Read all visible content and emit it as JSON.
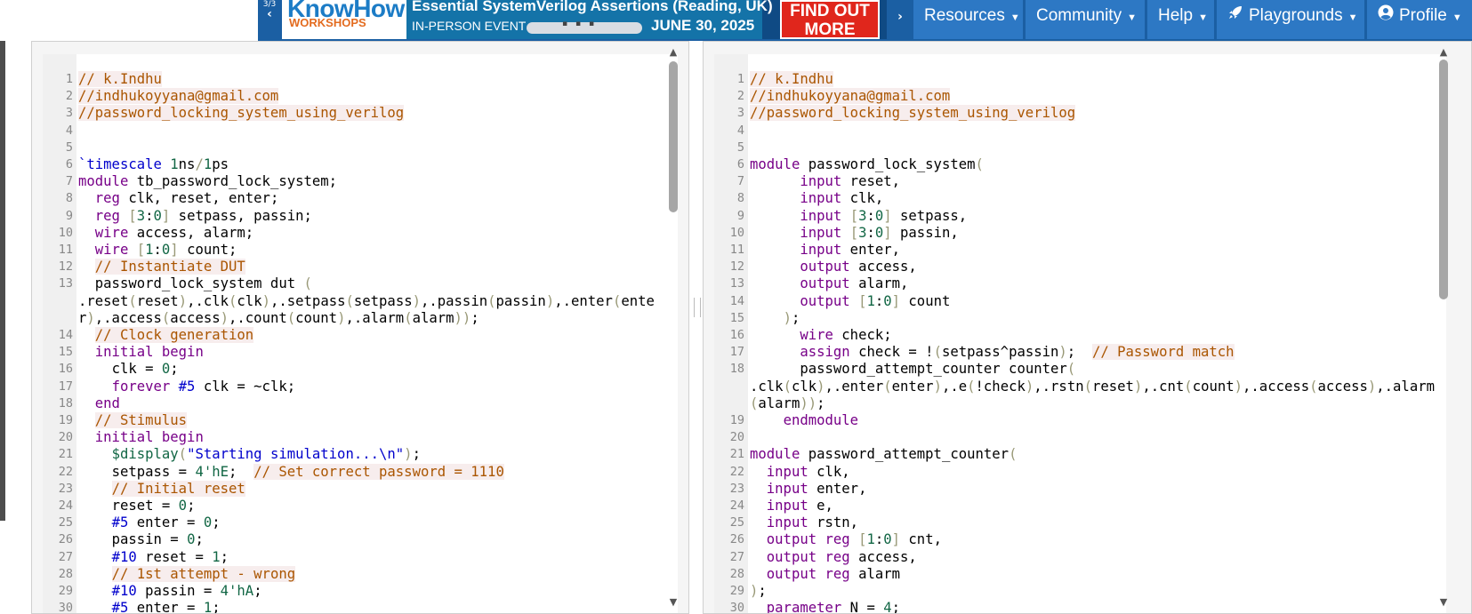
{
  "banner": {
    "counter": "3/3",
    "prev_arrow": "‹",
    "logo_title": "KnowHow",
    "logo_sub": "WORKSHOPS",
    "title": "Essential SystemVerilog Assertions (Reading, UK)",
    "event": "IN-PERSON EVENT",
    "date": "JUNE 30, 2025",
    "cta": "FIND OUT MORE"
  },
  "nav": {
    "next_arrow": "›",
    "resources": "Resources",
    "community": "Community",
    "help": "Help",
    "playgrounds": "Playgrounds",
    "profile": "Profile"
  },
  "left_editor": {
    "lines": [
      {
        "n": "1",
        "h": "<span class='c'>// k.Indhu</span>"
      },
      {
        "n": "2",
        "h": "<span class='c'>//indhukoyyana@gmail.com</span>"
      },
      {
        "n": "3",
        "h": "<span class='c'>//password_locking_system_using_verilog</span>"
      },
      {
        "n": "4",
        "h": ""
      },
      {
        "n": "5",
        "h": ""
      },
      {
        "n": "6",
        "h": "<span class='t'>`timescale</span> <span class='n'>1</span>ns<span class='b'>/</span><span class='n'>1</span>ps"
      },
      {
        "n": "7",
        "h": "<span class='k'>module</span> tb_password_lock_system;"
      },
      {
        "n": "8",
        "h": "  <span class='k'>reg</span> clk, reset, enter;"
      },
      {
        "n": "9",
        "h": "  <span class='k'>reg</span> <span class='b'>[</span><span class='n'>3</span>:<span class='n'>0</span><span class='b'>]</span> setpass, passin;"
      },
      {
        "n": "10",
        "h": "  <span class='k'>wire</span> access, alarm;"
      },
      {
        "n": "11",
        "h": "  <span class='k'>wire</span> <span class='b'>[</span><span class='n'>1</span>:<span class='n'>0</span><span class='b'>]</span> count;"
      },
      {
        "n": "12",
        "h": "  <span class='c'>// Instantiate DUT</span>"
      },
      {
        "n": "13",
        "h": "  password_lock_system dut <span class='b'>(</span>\n.reset<span class='b'>(</span>reset<span class='b'>)</span>,.clk<span class='b'>(</span>clk<span class='b'>)</span>,.setpass<span class='b'>(</span>setpass<span class='b'>)</span>,.passin<span class='b'>(</span>passin<span class='b'>)</span>,.enter<span class='b'>(</span>enter<span class='b'>)</span>,.access<span class='b'>(</span>access<span class='b'>)</span>,.count<span class='b'>(</span>count<span class='b'>)</span>,.alarm<span class='b'>(</span>alarm<span class='b'>))</span>;"
      },
      {
        "n": "14",
        "h": "  <span class='c'>// Clock generation</span>"
      },
      {
        "n": "15",
        "h": "  <span class='k'>initial</span> <span class='k'>begin</span>"
      },
      {
        "n": "16",
        "h": "    clk = <span class='n'>0</span>;"
      },
      {
        "n": "17",
        "h": "    <span class='k'>forever</span> <span class='t'>#5</span> clk = ~clk;"
      },
      {
        "n": "18",
        "h": "  <span class='k'>end</span>"
      },
      {
        "n": "19",
        "h": "  <span class='c'>// Stimulus</span>"
      },
      {
        "n": "20",
        "h": "  <span class='k'>initial</span> <span class='k'>begin</span>"
      },
      {
        "n": "21",
        "h": "    <span class='n'>$display</span><span class='b'>(</span><span class='s2'>\"Starting simulation...\\n\"</span><span class='b'>)</span>;"
      },
      {
        "n": "22",
        "h": "    setpass = <span class='n'>4'hE</span>;  <span class='c'>// Set correct password = 1110</span>"
      },
      {
        "n": "23",
        "h": "    <span class='c'>// Initial reset</span>"
      },
      {
        "n": "24",
        "h": "    reset = <span class='n'>0</span>;"
      },
      {
        "n": "25",
        "h": "    <span class='t'>#5</span> enter = <span class='n'>0</span>;"
      },
      {
        "n": "26",
        "h": "    passin = <span class='n'>0</span>;"
      },
      {
        "n": "27",
        "h": "    <span class='t'>#10</span> reset = <span class='n'>1</span>;"
      },
      {
        "n": "28",
        "h": "    <span class='c'>// 1st attempt - wrong</span>"
      },
      {
        "n": "29",
        "h": "    <span class='t'>#10</span> passin = <span class='n'>4'hA</span>;"
      },
      {
        "n": "30",
        "h": "    <span class='t'>#5</span> enter = <span class='n'>1</span>;"
      }
    ]
  },
  "right_editor": {
    "lines": [
      {
        "n": "1",
        "h": "<span class='c'>// k.Indhu</span>"
      },
      {
        "n": "2",
        "h": "<span class='c'>//indhukoyyana@gmail.com</span>"
      },
      {
        "n": "3",
        "h": "<span class='c'>//password_locking_system_using_verilog</span>"
      },
      {
        "n": "4",
        "h": ""
      },
      {
        "n": "5",
        "h": ""
      },
      {
        "n": "6",
        "h": "<span class='k'>module</span> password_lock_system<span class='b'>(</span>"
      },
      {
        "n": "7",
        "h": "      <span class='k'>input</span> reset,"
      },
      {
        "n": "8",
        "h": "      <span class='k'>input</span> clk,"
      },
      {
        "n": "9",
        "h": "      <span class='k'>input</span> <span class='b'>[</span><span class='n'>3</span>:<span class='n'>0</span><span class='b'>]</span> setpass,"
      },
      {
        "n": "10",
        "h": "      <span class='k'>input</span> <span class='b'>[</span><span class='n'>3</span>:<span class='n'>0</span><span class='b'>]</span> passin,"
      },
      {
        "n": "11",
        "h": "      <span class='k'>input</span> enter,"
      },
      {
        "n": "12",
        "h": "      <span class='k'>output</span> access,"
      },
      {
        "n": "13",
        "h": "      <span class='k'>output</span> alarm,"
      },
      {
        "n": "14",
        "h": "      <span class='k'>output</span> <span class='b'>[</span><span class='n'>1</span>:<span class='n'>0</span><span class='b'>]</span> count"
      },
      {
        "n": "15",
        "h": "    <span class='b'>)</span>;"
      },
      {
        "n": "16",
        "h": "      <span class='k'>wire</span> check;"
      },
      {
        "n": "17",
        "h": "      <span class='k'>assign</span> check = !<span class='b'>(</span>setpass^passin<span class='b'>)</span>;  <span class='c'>// Password match</span>"
      },
      {
        "n": "18",
        "h": "      password_attempt_counter counter<span class='b'>(</span>\n.clk<span class='b'>(</span>clk<span class='b'>)</span>,.enter<span class='b'>(</span>enter<span class='b'>)</span>,.e<span class='b'>(</span>!check<span class='b'>)</span>,.rstn<span class='b'>(</span>reset<span class='b'>)</span>,.cnt<span class='b'>(</span>count<span class='b'>)</span>,.access<span class='b'>(</span>access<span class='b'>)</span>,.alarm<span class='b'>(</span>alarm<span class='b'>))</span>;"
      },
      {
        "n": "19",
        "h": "    <span class='k'>endmodule</span>"
      },
      {
        "n": "20",
        "h": ""
      },
      {
        "n": "21",
        "h": "<span class='k'>module</span> password_attempt_counter<span class='b'>(</span>"
      },
      {
        "n": "22",
        "h": "  <span class='k'>input</span> clk,"
      },
      {
        "n": "23",
        "h": "  <span class='k'>input</span> enter,"
      },
      {
        "n": "24",
        "h": "  <span class='k'>input</span> e,"
      },
      {
        "n": "25",
        "h": "  <span class='k'>input</span> rstn,"
      },
      {
        "n": "26",
        "h": "  <span class='k'>output</span> <span class='k'>reg</span> <span class='b'>[</span><span class='n'>1</span>:<span class='n'>0</span><span class='b'>]</span> cnt,"
      },
      {
        "n": "27",
        "h": "  <span class='k'>output</span> <span class='k'>reg</span> access,"
      },
      {
        "n": "28",
        "h": "  <span class='k'>output</span> <span class='k'>reg</span> alarm"
      },
      {
        "n": "29",
        "h": "<span class='b'>)</span>;"
      },
      {
        "n": "30",
        "h": "  <span class='k'>parameter</span> N = <span class='n'>4</span>;"
      }
    ]
  },
  "scroll": {
    "up_arrow": "▲",
    "down_arrow": "▼"
  },
  "colors": {
    "navbar": "#1b5fa3",
    "nav_button": "#2d78c4",
    "keyword": "#770088",
    "comment": "#aa5500",
    "number": "#116644"
  },
  "icons": {
    "playgrounds": "rocket-icon",
    "profile": "user-circle-icon"
  }
}
